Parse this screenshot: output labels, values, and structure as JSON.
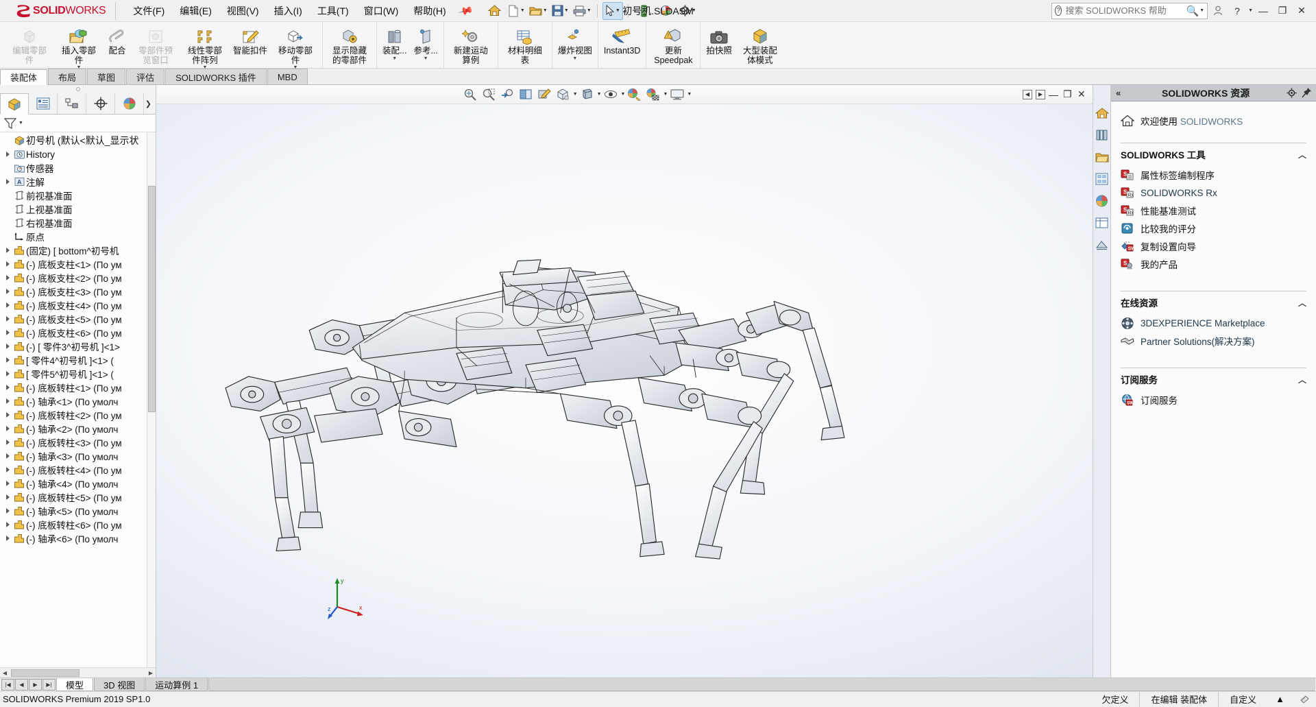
{
  "app": {
    "brand_ds": "2S",
    "brand_solid": "SOLID",
    "brand_works": "WORKS",
    "document_title": "初号机.SLDASM",
    "version_status": "SOLIDWORKS Premium 2019 SP1.0"
  },
  "menu": [
    {
      "label": "文件(F)"
    },
    {
      "label": "编辑(E)"
    },
    {
      "label": "视图(V)"
    },
    {
      "label": "插入(I)"
    },
    {
      "label": "工具(T)"
    },
    {
      "label": "窗口(W)"
    },
    {
      "label": "帮助(H)"
    }
  ],
  "search": {
    "placeholder": "搜索 SOLIDWORKS 帮助",
    "value": ""
  },
  "window_controls": {
    "account": "account-icon",
    "help": "?",
    "minimize": "—",
    "restore": "❐",
    "close": "✕"
  },
  "ribbon": {
    "groups": [
      {
        "buttons": [
          {
            "label": "编辑零部件",
            "icon": "edit-component-icon",
            "disabled": true,
            "dropdown": false
          },
          {
            "label": "插入零部件",
            "icon": "insert-component-icon",
            "disabled": false,
            "dropdown": true
          },
          {
            "label": "配合",
            "icon": "mate-icon",
            "disabled": false,
            "dropdown": false
          },
          {
            "label": "零部件预览窗口",
            "icon": "component-preview-icon",
            "disabled": true,
            "dropdown": false
          },
          {
            "label": "线性零部件阵列",
            "icon": "linear-component-pattern-icon",
            "disabled": false,
            "dropdown": true
          },
          {
            "label": "智能扣件",
            "icon": "smart-fasteners-icon",
            "disabled": false,
            "dropdown": false
          },
          {
            "label": "移动零部件",
            "icon": "move-component-icon",
            "disabled": false,
            "dropdown": true
          }
        ]
      },
      {
        "buttons": [
          {
            "label": "显示隐藏的零部件",
            "icon": "show-hidden-components-icon",
            "disabled": false,
            "dropdown": false
          }
        ]
      },
      {
        "buttons": [
          {
            "label": "装配...",
            "icon": "assembly-features-icon",
            "disabled": false,
            "dropdown": true
          },
          {
            "label": "参考...",
            "icon": "reference-geometry-icon",
            "disabled": false,
            "dropdown": true
          }
        ]
      },
      {
        "buttons": [
          {
            "label": "新建运动算例",
            "icon": "new-motion-study-icon",
            "disabled": false,
            "dropdown": false
          }
        ]
      },
      {
        "buttons": [
          {
            "label": "材料明细表",
            "icon": "bill-of-materials-icon",
            "disabled": false,
            "dropdown": false
          }
        ]
      },
      {
        "buttons": [
          {
            "label": "爆炸视图",
            "icon": "exploded-view-icon",
            "disabled": false,
            "dropdown": true
          }
        ]
      },
      {
        "buttons": [
          {
            "label": "Instant3D",
            "icon": "instant3d-icon",
            "disabled": false,
            "dropdown": false
          }
        ]
      },
      {
        "buttons": [
          {
            "label": "更新 Speedpak",
            "icon": "update-speedpak-icon",
            "disabled": false,
            "dropdown": false
          }
        ]
      },
      {
        "buttons": [
          {
            "label": "拍快照",
            "icon": "take-snapshot-icon",
            "disabled": false,
            "dropdown": false
          },
          {
            "label": "大型装配体模式",
            "icon": "large-assembly-mode-icon",
            "disabled": false,
            "dropdown": false
          }
        ]
      }
    ]
  },
  "command_tabs": [
    {
      "label": "装配体",
      "active": true
    },
    {
      "label": "布局",
      "active": false
    },
    {
      "label": "草图",
      "active": false
    },
    {
      "label": "评估",
      "active": false
    },
    {
      "label": "SOLIDWORKS 插件",
      "active": false
    },
    {
      "label": "MBD",
      "active": false
    }
  ],
  "left_panel": {
    "tabs": [
      {
        "name": "feature-manager-tab",
        "active": true
      },
      {
        "name": "property-manager-tab",
        "active": false
      },
      {
        "name": "configuration-manager-tab",
        "active": false
      },
      {
        "name": "dimxpert-manager-tab",
        "active": false
      },
      {
        "name": "display-manager-tab",
        "active": false
      }
    ],
    "filter_placeholder": "",
    "tree": [
      {
        "label": "初号机  (默认<默认_显示状",
        "icon": "assembly-icon",
        "arrow": false,
        "indent": 0,
        "root": true
      },
      {
        "label": "History",
        "icon": "history-icon",
        "arrow": true,
        "indent": 1
      },
      {
        "label": "传感器",
        "icon": "sensors-icon",
        "arrow": false,
        "indent": 1
      },
      {
        "label": "注解",
        "icon": "annotations-icon",
        "arrow": true,
        "indent": 1
      },
      {
        "label": "前视基准面",
        "icon": "plane-icon",
        "arrow": false,
        "indent": 1
      },
      {
        "label": "上视基准面",
        "icon": "plane-icon",
        "arrow": false,
        "indent": 1
      },
      {
        "label": "右视基准面",
        "icon": "plane-icon",
        "arrow": false,
        "indent": 1
      },
      {
        "label": "原点",
        "icon": "origin-icon",
        "arrow": false,
        "indent": 1
      },
      {
        "label": "(固定) [ bottom^初号机",
        "icon": "part-icon",
        "arrow": true,
        "indent": 1
      },
      {
        "label": "(-) 底板支柱<1> (По ум",
        "icon": "part-icon",
        "arrow": true,
        "indent": 1
      },
      {
        "label": "(-) 底板支柱<2> (По ум",
        "icon": "part-icon",
        "arrow": true,
        "indent": 1
      },
      {
        "label": "(-) 底板支柱<3> (По ум",
        "icon": "part-icon",
        "arrow": true,
        "indent": 1
      },
      {
        "label": "(-) 底板支柱<4> (По ум",
        "icon": "part-icon",
        "arrow": true,
        "indent": 1
      },
      {
        "label": "(-) 底板支柱<5> (По ум",
        "icon": "part-icon",
        "arrow": true,
        "indent": 1
      },
      {
        "label": "(-) 底板支柱<6> (По ум",
        "icon": "part-icon",
        "arrow": true,
        "indent": 1
      },
      {
        "label": "(-) [ 零件3^初号机 ]<1>",
        "icon": "part-icon",
        "arrow": true,
        "indent": 1
      },
      {
        "label": "[ 零件4^初号机 ]<1> (",
        "icon": "part-icon",
        "arrow": true,
        "indent": 1
      },
      {
        "label": "[ 零件5^初号机 ]<1> (",
        "icon": "part-icon",
        "arrow": true,
        "indent": 1
      },
      {
        "label": "(-) 底板转柱<1> (По ум",
        "icon": "part-icon",
        "arrow": true,
        "indent": 1
      },
      {
        "label": "(-) 轴承<1> (По умолч",
        "icon": "part-icon",
        "arrow": true,
        "indent": 1
      },
      {
        "label": "(-) 底板转柱<2> (По ум",
        "icon": "part-icon",
        "arrow": true,
        "indent": 1
      },
      {
        "label": "(-) 轴承<2> (По умолч",
        "icon": "part-icon",
        "arrow": true,
        "indent": 1
      },
      {
        "label": "(-) 底板转柱<3> (По ум",
        "icon": "part-icon",
        "arrow": true,
        "indent": 1
      },
      {
        "label": "(-) 轴承<3> (По умолч",
        "icon": "part-icon",
        "arrow": true,
        "indent": 1
      },
      {
        "label": "(-) 底板转柱<4> (По ум",
        "icon": "part-icon",
        "arrow": true,
        "indent": 1
      },
      {
        "label": "(-) 轴承<4> (По умолч",
        "icon": "part-icon",
        "arrow": true,
        "indent": 1
      },
      {
        "label": "(-) 底板转柱<5> (По ум",
        "icon": "part-icon",
        "arrow": true,
        "indent": 1
      },
      {
        "label": "(-) 轴承<5> (По умолч",
        "icon": "part-icon",
        "arrow": true,
        "indent": 1
      },
      {
        "label": "(-) 底板转柱<6> (По ум",
        "icon": "part-icon",
        "arrow": true,
        "indent": 1
      },
      {
        "label": "(-) 轴承<6> (По умолч",
        "icon": "part-icon",
        "arrow": true,
        "indent": 1
      }
    ]
  },
  "view_toolbar": [
    {
      "name": "zoom-to-fit-icon"
    },
    {
      "name": "zoom-to-area-icon"
    },
    {
      "name": "previous-view-icon"
    },
    {
      "name": "section-view-icon"
    },
    {
      "name": "view-orientation-icon"
    },
    {
      "name": "display-style-icon",
      "dropdown": true
    },
    {
      "name": "hide-show-items-icon",
      "dropdown": true
    },
    {
      "name": "edit-appearance-icon",
      "dropdown": true
    },
    {
      "name": "apply-scene-icon",
      "dropdown": true
    },
    {
      "name": "view-settings-icon",
      "dropdown": true
    }
  ],
  "task_pane": {
    "title": "SOLIDWORKS 资源",
    "collapse_icon": "chevron-left-icon",
    "gear_icon": "gear-icon",
    "pin_icon": "pin-icon",
    "welcome": {
      "main": "欢迎使用",
      "sub": "SOLIDWORKS",
      "icon": "home-icon"
    },
    "sections": [
      {
        "title": "SOLIDWORKS 工具",
        "items": [
          {
            "label": "属性标签编制程序",
            "icon": "property-tab-builder-icon",
            "link": false
          },
          {
            "label": "SOLIDWORKS Rx",
            "icon": "solidworks-rx-icon",
            "link": true
          },
          {
            "label": "性能基准测试",
            "icon": "performance-benchmark-icon",
            "link": false
          },
          {
            "label": "比较我的评分",
            "icon": "compare-my-score-icon",
            "link": false
          },
          {
            "label": "复制设置向导",
            "icon": "copy-settings-wizard-icon",
            "link": false
          },
          {
            "label": "我的产品",
            "icon": "my-products-icon",
            "link": false
          }
        ]
      },
      {
        "title": "在线资源",
        "items": [
          {
            "label": "3DEXPERIENCE Marketplace",
            "icon": "marketplace-icon",
            "link": true
          },
          {
            "label": "Partner Solutions(解决方案)",
            "icon": "partner-solutions-icon",
            "link": true
          }
        ]
      },
      {
        "title": "订阅服务",
        "items": [
          {
            "label": "订阅服务",
            "icon": "subscription-services-icon",
            "link": false
          }
        ]
      }
    ]
  },
  "bottom_tabs": [
    {
      "label": "模型",
      "active": true
    },
    {
      "label": "3D 视图",
      "active": false
    },
    {
      "label": "运动算例 1",
      "active": false
    }
  ],
  "status_bar": {
    "left": "SOLIDWORKS Premium 2019 SP1.0",
    "cells": [
      "欠定义",
      "在编辑 装配体",
      "自定义"
    ],
    "expand_icon": "▲"
  },
  "triad": {
    "x_label": "x",
    "y_label": "y",
    "z_label": "z"
  },
  "colors": {
    "brand_red": "#c8102e",
    "accent_blue": "#3b6ea5",
    "tab_active": "#fdfdfd",
    "panel_header": "#c6c9cd"
  }
}
